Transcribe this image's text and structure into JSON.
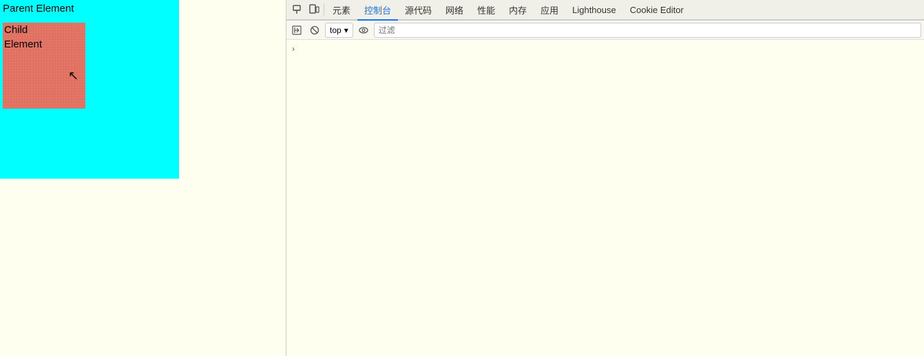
{
  "preview": {
    "parent_label": "Parent Element",
    "child_label_line1": "Child",
    "child_label_line2": "Element"
  },
  "devtools": {
    "toolbar_icons": [
      {
        "name": "cursor-icon",
        "symbol": "↖"
      },
      {
        "name": "device-icon",
        "symbol": "⬜"
      }
    ],
    "tabs": [
      {
        "id": "elements",
        "label": "元素"
      },
      {
        "id": "console",
        "label": "控制台",
        "active": true
      },
      {
        "id": "sources",
        "label": "源代码"
      },
      {
        "id": "network",
        "label": "网络"
      },
      {
        "id": "performance",
        "label": "性能"
      },
      {
        "id": "memory",
        "label": "内存"
      },
      {
        "id": "application",
        "label": "应用"
      },
      {
        "id": "lighthouse",
        "label": "Lighthouse"
      },
      {
        "id": "cookie-editor",
        "label": "Cookie Editor"
      }
    ],
    "console_toolbar": {
      "run_icon": "▶",
      "block_icon": "⊘",
      "top_label": "top",
      "dropdown_arrow": "▾",
      "eye_icon": "👁",
      "filter_placeholder": "过滤"
    },
    "console_prompt_arrow": "›"
  },
  "colors": {
    "parent_bg": "#00ffff",
    "child_bg": "#e07060",
    "active_tab_color": "#1a73e8",
    "page_bg": "#fffff0"
  }
}
